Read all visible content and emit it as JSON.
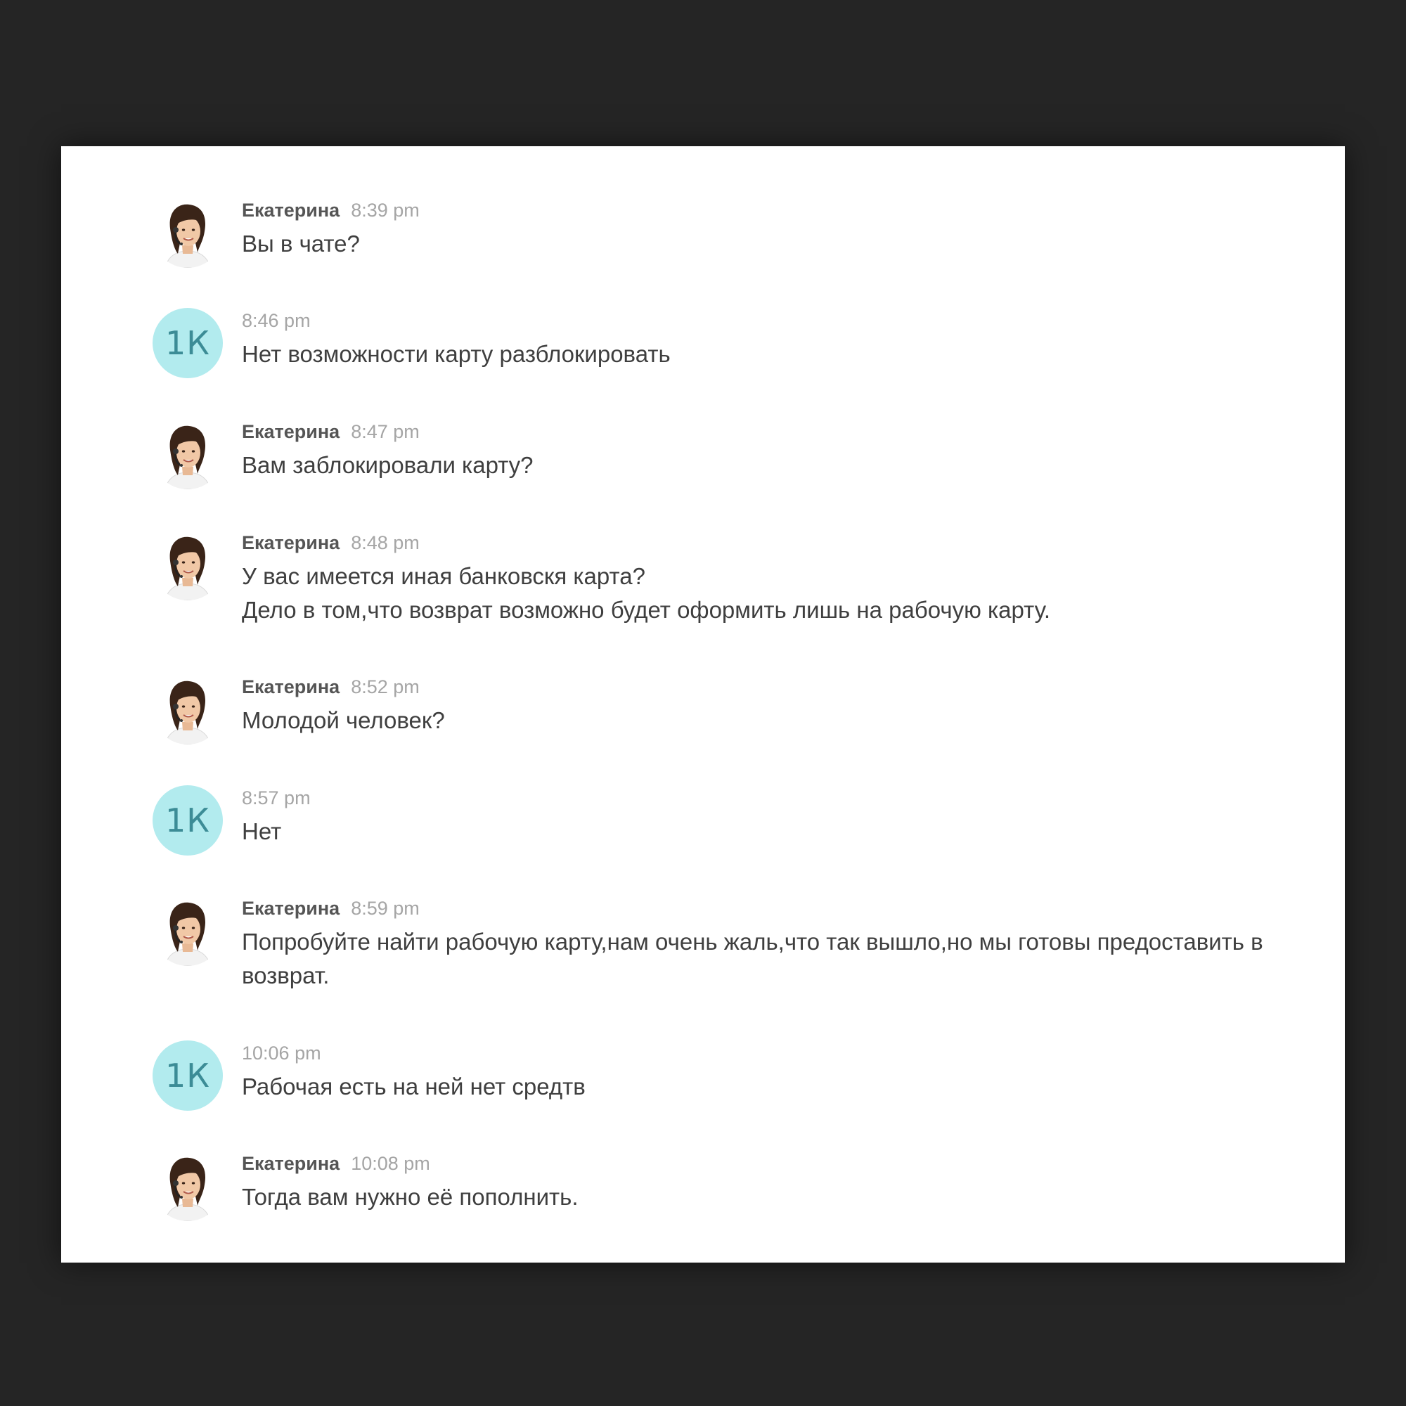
{
  "messages": [
    {
      "sender": "agent",
      "author": "Екатерина",
      "time": "8:39 pm",
      "lines": [
        "Вы в чате?"
      ]
    },
    {
      "sender": "user",
      "initials": "1К",
      "time": "8:46 pm",
      "lines": [
        "Нет возможности карту разблокировать"
      ]
    },
    {
      "sender": "agent",
      "author": "Екатерина",
      "time": "8:47 pm",
      "lines": [
        "Вам заблокировали карту?"
      ]
    },
    {
      "sender": "agent",
      "author": "Екатерина",
      "time": "8:48 pm",
      "lines": [
        "У вас имеется иная банковскя карта?",
        "Дело в том,что возврат возможно будет оформить лишь на рабочую карту."
      ]
    },
    {
      "sender": "agent",
      "author": "Екатерина",
      "time": "8:52 pm",
      "lines": [
        "Молодой человек?"
      ]
    },
    {
      "sender": "user",
      "initials": "1К",
      "time": "8:57 pm",
      "lines": [
        "Нет"
      ]
    },
    {
      "sender": "agent",
      "author": "Екатерина",
      "time": "8:59 pm",
      "lines": [
        "Попробуйте найти рабочую карту,нам очень жаль,что так вышло,но мы готовы предоставить в",
        "возврат."
      ]
    },
    {
      "sender": "user",
      "initials": "1К",
      "time": "10:06 pm",
      "lines": [
        "Рабочая есть на ней нет средтв"
      ]
    },
    {
      "sender": "agent",
      "author": "Екатерина",
      "time": "10:08 pm",
      "lines": [
        "Тогда вам нужно её пополнить."
      ]
    }
  ],
  "colors": {
    "background": "#252525",
    "panel": "#ffffff",
    "user_avatar_bg": "#b2ebee",
    "user_avatar_text": "#3c8c96",
    "author": "#555555",
    "timestamp": "#a5a5a5",
    "message_text": "#3f3f3f"
  },
  "icons": {
    "agent_avatar": "agent-photo-avatar",
    "user_avatar": "initials-avatar"
  }
}
